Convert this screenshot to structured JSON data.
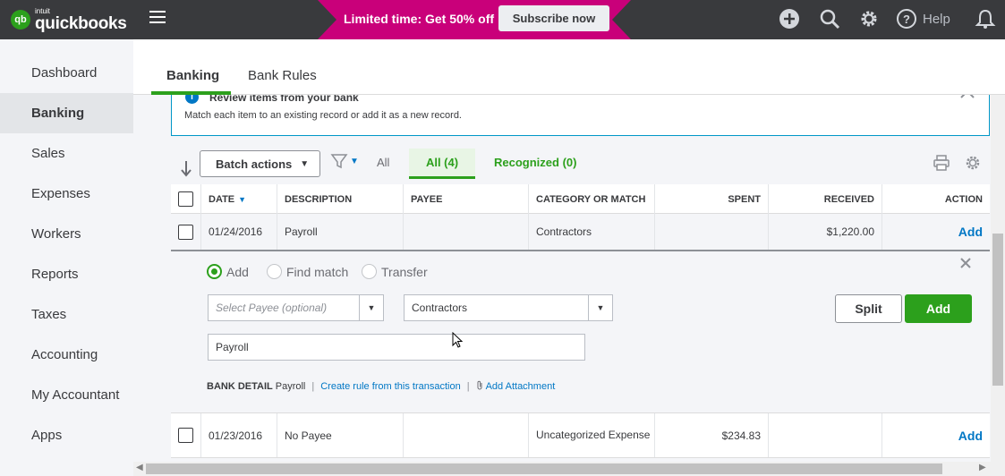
{
  "app": {
    "logo_intuit": "intuit",
    "logo_name": "quickbooks",
    "logo_mark": "qb"
  },
  "promo": {
    "text": "Limited time: Get 50% off",
    "button": "Subscribe now"
  },
  "top_icons": {
    "help_label": "Help"
  },
  "sidebar": {
    "items": [
      {
        "label": "Dashboard"
      },
      {
        "label": "Banking"
      },
      {
        "label": "Sales"
      },
      {
        "label": "Expenses"
      },
      {
        "label": "Workers"
      },
      {
        "label": "Reports"
      },
      {
        "label": "Taxes"
      },
      {
        "label": "Accounting"
      },
      {
        "label": "My Accountant"
      },
      {
        "label": "Apps"
      }
    ],
    "active": "Banking"
  },
  "tabs": {
    "banking": "Banking",
    "bank_rules": "Bank Rules"
  },
  "review": {
    "title": "Review items from your bank",
    "subtitle": "Match each item to an existing record or add it as a new record."
  },
  "toolbar": {
    "batch_actions": "Batch actions",
    "filter_all": "All",
    "all_count": "All (4)",
    "recognized": "Recognized (0)"
  },
  "table": {
    "headers": {
      "date": "DATE",
      "description": "DESCRIPTION",
      "payee": "PAYEE",
      "category": "CATEGORY OR MATCH",
      "spent": "SPENT",
      "received": "RECEIVED",
      "action": "ACTION"
    },
    "rows": [
      {
        "date": "01/24/2016",
        "description": "Payroll",
        "payee": "",
        "category": "Contractors",
        "spent": "",
        "received": "$1,220.00",
        "action": "Add"
      },
      {
        "date": "01/23/2016",
        "description": "No Payee",
        "payee": "",
        "category": "Uncategorized Expense",
        "spent": "$234.83",
        "received": "",
        "action": "Add"
      }
    ]
  },
  "expanded": {
    "radio_add": "Add",
    "radio_find_match": "Find match",
    "radio_transfer": "Transfer",
    "payee_placeholder": "Select Payee (optional)",
    "category_value": "Contractors",
    "memo_value": "Payroll",
    "split_label": "Split",
    "add_label": "Add",
    "bank_detail_label": "BANK DETAIL",
    "bank_detail_value": "Payroll",
    "create_rule_link": "Create rule from this transaction",
    "add_attachment_link": "Add Attachment"
  },
  "colors": {
    "topbar": "#393a3d",
    "promo": "#c9007a",
    "accent_green": "#2ca01c",
    "link_blue": "#0077c5"
  }
}
